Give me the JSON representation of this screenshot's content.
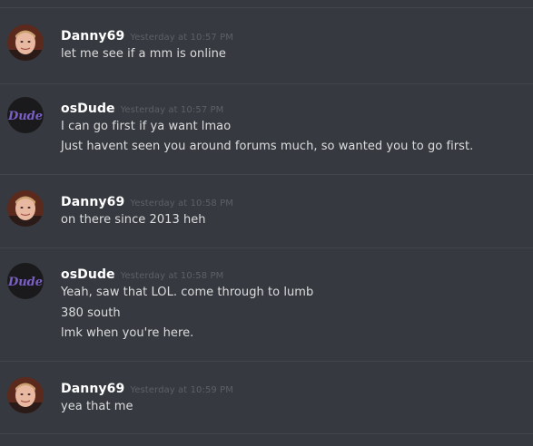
{
  "messages": [
    {
      "author": "Danny69",
      "avatar_icon": "user-avatar-icon",
      "timestamp": "Yesterday at 10:57 PM",
      "lines": [
        "let me see if a mm is online"
      ]
    },
    {
      "author": "osDude",
      "avatar_icon": "dude-logo-avatar-icon",
      "timestamp": "Yesterday at 10:57 PM",
      "lines": [
        "I can go first if ya want lmao",
        "Just havent seen you around forums much, so wanted you to go first."
      ]
    },
    {
      "author": "Danny69",
      "avatar_icon": "user-avatar-icon",
      "timestamp": "Yesterday at 10:58 PM",
      "lines": [
        "on there since 2013 heh"
      ]
    },
    {
      "author": "osDude",
      "avatar_icon": "dude-logo-avatar-icon",
      "timestamp": "Yesterday at 10:58 PM",
      "lines": [
        "Yeah, saw that LOL. come through to lumb",
        "380 south",
        "lmk when you're here."
      ]
    },
    {
      "author": "Danny69",
      "avatar_icon": "user-avatar-icon",
      "timestamp": "Yesterday at 10:59 PM",
      "lines": [
        "yea that me"
      ]
    }
  ],
  "avatar_logo_text": "Dude",
  "colors": {
    "background": "#36393f",
    "divider": "#42454a",
    "username": "#ffffff",
    "timestamp": "#5d6066",
    "message_text": "#dcddde",
    "logo_purple": "#7b5fc7"
  }
}
